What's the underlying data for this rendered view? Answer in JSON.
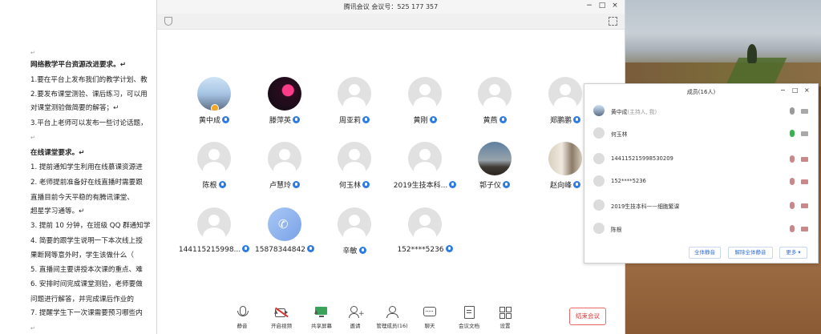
{
  "document": {
    "lines": [
      {
        "text": "↵",
        "cls": "mark"
      },
      {
        "text": "网络教学平台资源改进要求。↵",
        "cls": "h"
      },
      {
        "text": "1.要在平台上发布我们的教学计划、教",
        "cls": ""
      },
      {
        "text": "2.要发布课堂测验、课后练习，可以用",
        "cls": ""
      },
      {
        "text": "对课堂测验做简要的解答；↵",
        "cls": ""
      },
      {
        "text": "3.平台上老师可以发布一些讨论话题，",
        "cls": ""
      },
      {
        "text": "↵",
        "cls": "mark"
      },
      {
        "text": "在线课堂要求。↵",
        "cls": "h"
      },
      {
        "text": "1.  提前通知学生利用在线慕课资源进",
        "cls": ""
      },
      {
        "text": "2.  老师提前准备好在线直播时需要跟",
        "cls": ""
      },
      {
        "text": "     直播目前今天平稳的有腾讯课堂、",
        "cls": ""
      },
      {
        "text": "     超星学习通等。↵",
        "cls": ""
      },
      {
        "text": "3.  提前 10 分钟，在班级 QQ 群通知学",
        "cls": ""
      },
      {
        "text": "4.  简要的跟学生说明一下本次线上授",
        "cls": ""
      },
      {
        "text": "     果断网等意外时，学生该做什么（",
        "cls": ""
      },
      {
        "text": "5.  直播间主要讲授本次课的重点、难",
        "cls": ""
      },
      {
        "text": "6.  安排时间完成课堂测验，老师要做",
        "cls": ""
      },
      {
        "text": "     问题进行解答，并完成课后作业的",
        "cls": ""
      },
      {
        "text": "7.  提醒学生下一次课需要预习哪些内",
        "cls": ""
      },
      {
        "text": "↵",
        "cls": "mark"
      }
    ]
  },
  "meeting": {
    "title": "腾讯会议 会议号：525 177 357",
    "window_buttons": [
      "−",
      "□",
      "×"
    ],
    "participants": [
      {
        "name": "黄中成",
        "avatar": "av-photo1",
        "host": true
      },
      {
        "name": "滕萍英",
        "avatar": "av-photo2",
        "host": false
      },
      {
        "name": "周亚莉",
        "avatar": "default",
        "host": false
      },
      {
        "name": "黄刚",
        "avatar": "default",
        "host": false
      },
      {
        "name": "黄燕",
        "avatar": "default",
        "host": false
      },
      {
        "name": "郑鹏鹏",
        "avatar": "default",
        "host": false
      },
      {
        "name": "陈根",
        "avatar": "default",
        "host": false
      },
      {
        "name": "卢慧玲",
        "avatar": "default",
        "host": false
      },
      {
        "name": "何玉林",
        "avatar": "default",
        "host": false
      },
      {
        "name": "2019生技本科...",
        "avatar": "default",
        "host": false
      },
      {
        "name": "郭子仪",
        "avatar": "av-photo3",
        "host": false
      },
      {
        "name": "赵向峰",
        "avatar": "av-photo4",
        "host": false
      },
      {
        "name": "144115215998...",
        "avatar": "default",
        "host": false
      },
      {
        "name": "15878344842",
        "avatar": "av-phone",
        "host": false
      },
      {
        "name": "辛敏",
        "avatar": "default",
        "host": false
      },
      {
        "name": "152****5236",
        "avatar": "default",
        "host": false
      }
    ],
    "toolbar": [
      {
        "label": "静音",
        "icon": "microphone-icon"
      },
      {
        "label": "开启视频",
        "icon": "video-off-icon"
      },
      {
        "label": "共享屏幕",
        "icon": "share-screen-icon"
      },
      {
        "label": "邀请",
        "icon": "invite-icon"
      },
      {
        "label": "管理成员(16)",
        "icon": "members-icon"
      },
      {
        "label": "聊天",
        "icon": "chat-icon"
      },
      {
        "label": "会议文档",
        "icon": "document-icon"
      },
      {
        "label": "设置",
        "icon": "settings-icon"
      }
    ],
    "end_button": "结束会议"
  },
  "members_panel": {
    "title": "成员(16人)",
    "window_buttons": [
      "−",
      "□",
      "×"
    ],
    "rows": [
      {
        "name": "黄中成",
        "role": "(主持人, 我)",
        "mic": "normal",
        "cam": "normal"
      },
      {
        "name": "何玉林",
        "role": "",
        "mic": "on",
        "cam": "normal"
      },
      {
        "name": "144115215998530209",
        "role": "",
        "mic": "muted",
        "cam": "off"
      },
      {
        "name": "152****5236",
        "role": "",
        "mic": "muted",
        "cam": "off"
      },
      {
        "name": "2019生技本科——细胞繁课",
        "role": "",
        "mic": "muted",
        "cam": "off"
      },
      {
        "name": "陈根",
        "role": "",
        "mic": "muted",
        "cam": "off"
      }
    ],
    "buttons": {
      "mute_all": "全体静音",
      "unmute_all": "解除全体静音",
      "more": "更多 ▾"
    }
  },
  "colors": {
    "accent": "#2f7be5",
    "end": "#dd3333"
  }
}
